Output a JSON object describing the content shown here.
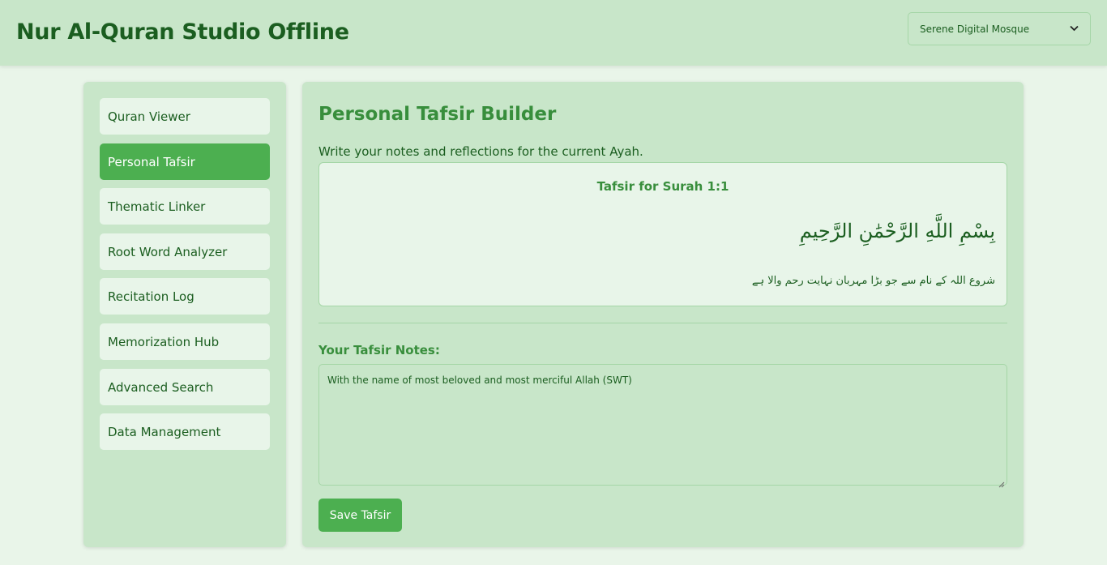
{
  "app": {
    "title": "Nur Al-Quran Studio Offline",
    "theme_select": {
      "selected": "Serene Digital Mosque"
    }
  },
  "sidebar": {
    "items": [
      {
        "label": "Quran Viewer",
        "active": false
      },
      {
        "label": "Personal Tafsir",
        "active": true
      },
      {
        "label": "Thematic Linker",
        "active": false
      },
      {
        "label": "Root Word Analyzer",
        "active": false
      },
      {
        "label": "Recitation Log",
        "active": false
      },
      {
        "label": "Memorization Hub",
        "active": false
      },
      {
        "label": "Advanced Search",
        "active": false
      },
      {
        "label": "Data Management",
        "active": false
      }
    ]
  },
  "main": {
    "title": "Personal Tafsir Builder",
    "intro": "Write your notes and reflections for the current Ayah.",
    "ayah": {
      "heading": "Tafsir for Surah 1:1",
      "arabic": "بِسْمِ اللَّهِ الرَّحْمَٰنِ الرَّحِيمِ",
      "urdu": "شروع اللہ کے نام سے جو بڑا مہربان نہایت رحم والا ہے"
    },
    "notes": {
      "label": "Your Tafsir Notes:",
      "value": "With the name of most beloved and most merciful Allah (SWT)"
    },
    "save_label": "Save Tafsir"
  },
  "colors": {
    "accent": "#4caf50",
    "heading": "#388e3c",
    "panel": "#c8e6c9",
    "background": "#e9f5e9"
  }
}
